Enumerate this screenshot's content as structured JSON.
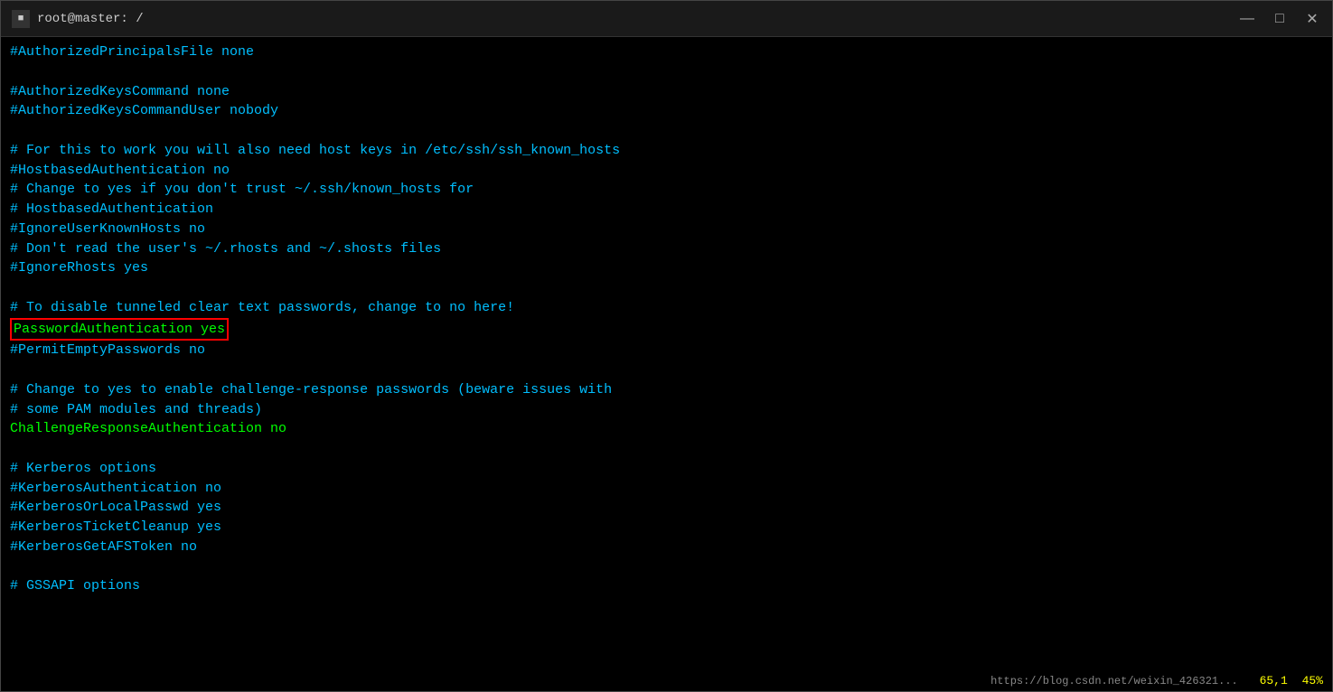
{
  "titleBar": {
    "icon": "■",
    "title": "root@master: /",
    "minimize": "—",
    "maximize": "□",
    "close": "✕"
  },
  "terminal": {
    "lines": [
      {
        "id": "l1",
        "text": "#AuthorizedPrincipalsFile none",
        "type": "comment"
      },
      {
        "id": "l2",
        "text": "",
        "type": "empty"
      },
      {
        "id": "l3",
        "text": "#AuthorizedKeysCommand none",
        "type": "comment"
      },
      {
        "id": "l4",
        "text": "#AuthorizedKeysCommandUser nobody",
        "type": "comment"
      },
      {
        "id": "l5",
        "text": "",
        "type": "empty"
      },
      {
        "id": "l6",
        "text": "# For this to work you will also need host keys in /etc/ssh/ssh_known_hosts",
        "type": "comment"
      },
      {
        "id": "l7",
        "text": "#HostbasedAuthentication no",
        "type": "comment"
      },
      {
        "id": "l8",
        "text": "# Change to yes if you don't trust ~/.ssh/known_hosts for",
        "type": "comment"
      },
      {
        "id": "l9",
        "text": "# HostbasedAuthentication",
        "type": "comment"
      },
      {
        "id": "l10",
        "text": "#IgnoreUserKnownHosts no",
        "type": "comment"
      },
      {
        "id": "l11",
        "text": "# Don't read the user's ~/.rhosts and ~/.shosts files",
        "type": "comment"
      },
      {
        "id": "l12",
        "text": "#IgnoreRhosts yes",
        "type": "comment"
      },
      {
        "id": "l13",
        "text": "",
        "type": "empty"
      },
      {
        "id": "l14",
        "text": "# To disable tunneled clear text passwords, change to no here!",
        "type": "comment"
      },
      {
        "id": "l15",
        "text": "PasswordAuthentication yes",
        "type": "highlighted"
      },
      {
        "id": "l16",
        "text": "#PermitEmptyPasswords no",
        "type": "comment"
      },
      {
        "id": "l17",
        "text": "",
        "type": "empty"
      },
      {
        "id": "l18",
        "text": "# Change to yes to enable challenge-response passwords (beware issues with",
        "type": "comment"
      },
      {
        "id": "l19",
        "text": "# some PAM modules and threads)",
        "type": "comment"
      },
      {
        "id": "l20",
        "text": "ChallengeResponseAuthentication no",
        "type": "active"
      },
      {
        "id": "l21",
        "text": "",
        "type": "empty"
      },
      {
        "id": "l22",
        "text": "# Kerberos options",
        "type": "comment"
      },
      {
        "id": "l23",
        "text": "#KerberosAuthentication no",
        "type": "comment"
      },
      {
        "id": "l24",
        "text": "#KerberosOrLocalPasswd yes",
        "type": "comment"
      },
      {
        "id": "l25",
        "text": "#KerberosTicketCleanup yes",
        "type": "comment"
      },
      {
        "id": "l26",
        "text": "#KerberosGetAFSToken no",
        "type": "comment"
      },
      {
        "id": "l27",
        "text": "",
        "type": "empty"
      },
      {
        "id": "l28",
        "text": "# GSSAPI options",
        "type": "comment"
      }
    ]
  },
  "statusBar": {
    "position": "65,1",
    "percent": "45%",
    "url": "https://blog.csdn.net/weixin_426321..."
  }
}
